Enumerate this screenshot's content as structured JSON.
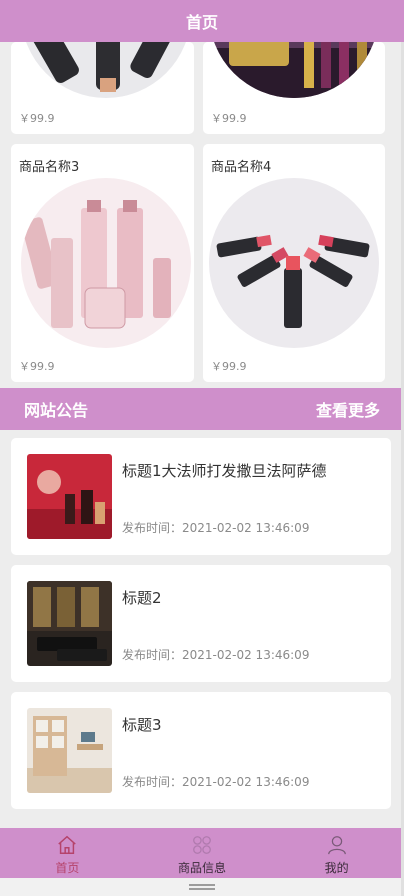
{
  "header": {
    "title": "首页"
  },
  "products": [
    {
      "name": "",
      "price": "￥99.9"
    },
    {
      "name": "",
      "price": "￥99.9"
    },
    {
      "name": "商品名称3",
      "price": "￥99.9"
    },
    {
      "name": "商品名称4",
      "price": "￥99.9"
    }
  ],
  "notice": {
    "title": "网站公告",
    "more": "查看更多"
  },
  "news": [
    {
      "title": "标题1大法师打发撒旦法阿萨德",
      "time": "发布时间：2021-02-02 13:46:09",
      "thumb_icon": "red-cosmetics-photo"
    },
    {
      "title": "标题2",
      "time": "发布时间：2021-02-02 13:46:09",
      "thumb_icon": "dark-interior-photo"
    },
    {
      "title": "标题3",
      "time": "发布时间：2021-02-02 13:46:09",
      "thumb_icon": "room-shelves-photo"
    }
  ],
  "tabbar": [
    {
      "label": "首页",
      "icon": "home-icon",
      "active": true
    },
    {
      "label": "商品信息",
      "icon": "grid-icon",
      "active": false
    },
    {
      "label": "我的",
      "icon": "user-icon",
      "active": false
    }
  ],
  "colors": {
    "accent": "#cf8fcb",
    "active_tab": "#b5436b"
  }
}
